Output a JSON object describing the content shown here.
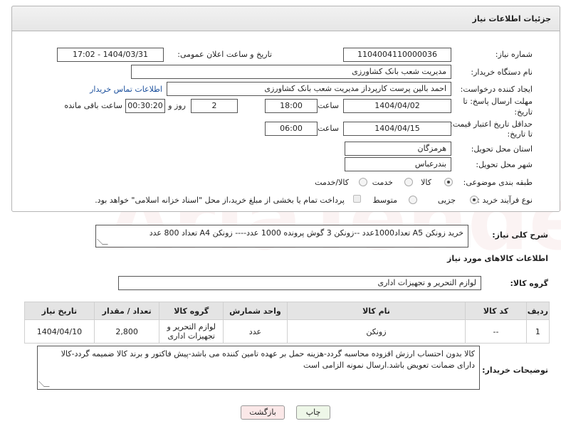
{
  "header": {
    "title": "جزئیات اطلاعات نیاز"
  },
  "fields": {
    "need_number_label": "شماره نیاز:",
    "need_number": "1104004110000036",
    "announce_label": "تاریخ و ساعت اعلان عمومی:",
    "announce_value": "1404/03/31 - 17:02",
    "buyer_org_label": "نام دستگاه خریدار:",
    "buyer_org": "مدیریت شعب بانک کشاورزی",
    "requester_label": "ایجاد کننده درخواست:",
    "requester": "احمد بالین پرست  کارپرداز مدیریت شعب بانک کشاورزی",
    "contact_link": "اطلاعات تماس خریدار",
    "deadline_label_1": "مهلت ارسال پاسخ: تا",
    "deadline_label_2": "تاریخ:",
    "deadline_date": "1404/04/02",
    "time_label": "ساعت",
    "deadline_time": "18:00",
    "days_value": "2",
    "days_label": "روز و",
    "remaining_time": "00:30:20",
    "remaining_label": "ساعت باقی مانده",
    "price_valid_label_1": "حداقل تاریخ اعتبار قیمت:",
    "price_valid_label_2": "تا تاریخ:",
    "price_valid_date": "1404/04/15",
    "price_valid_time": "06:00",
    "province_label": "استان محل تحویل:",
    "province": "هرمزگان",
    "city_label": "شهر محل تحویل:",
    "city": "بندرعباس",
    "category_label": "طبقه بندی موضوعی:",
    "category_options": [
      "کالا",
      "خدمت",
      "کالا/خدمت"
    ],
    "process_label": "نوع فرآیند خرید :",
    "process_options": [
      "جزیی",
      "متوسط"
    ],
    "payment_note": "پرداخت تمام یا بخشی از مبلغ خرید،از محل \"اسناد خزانه اسلامی\" خواهد بود."
  },
  "description": {
    "label": "شرح کلی نیاز:",
    "text": "خرید زونکن A5 تعداد1000عدد --زونکن 3 گوش پرونده 1000 عدد---- زونکن A4 تعداد 800 عدد"
  },
  "goods_info": {
    "title": "اطلاعات کالاهای مورد نیاز"
  },
  "goods_group": {
    "label": "گروه کالا:",
    "value": "لوازم التحریر و تجهیزات اداری"
  },
  "table": {
    "headers": [
      "ردیف",
      "کد کالا",
      "نام کالا",
      "واحد شمارش",
      "گروه کالا",
      "تعداد / مقدار",
      "تاریخ نیاز"
    ],
    "rows": [
      [
        "1",
        "--",
        "زونکن",
        "عدد",
        "لوازم التحریر و تجهیزات اداری",
        "2,800",
        "1404/04/10"
      ]
    ]
  },
  "buyer_notes": {
    "label": "توضیحات خریدار:",
    "text": "کالا بدون احتساب ارزش افزوده محاسبه گردد-هزینه حمل بر عهده تامین کننده می باشد-پیش فاکتور و برند کالا ضمیمه گردد-کالا دارای ضمانت  تعویض باشد.ارسال نمونه الزامی است"
  },
  "buttons": {
    "print": "چاپ",
    "back": "بازگشت"
  },
  "watermark": "AriaTender.net",
  "colors": {
    "link": "#1a4f9c",
    "print_bg": "#eef7e8",
    "back_bg": "#fbe8e8"
  }
}
